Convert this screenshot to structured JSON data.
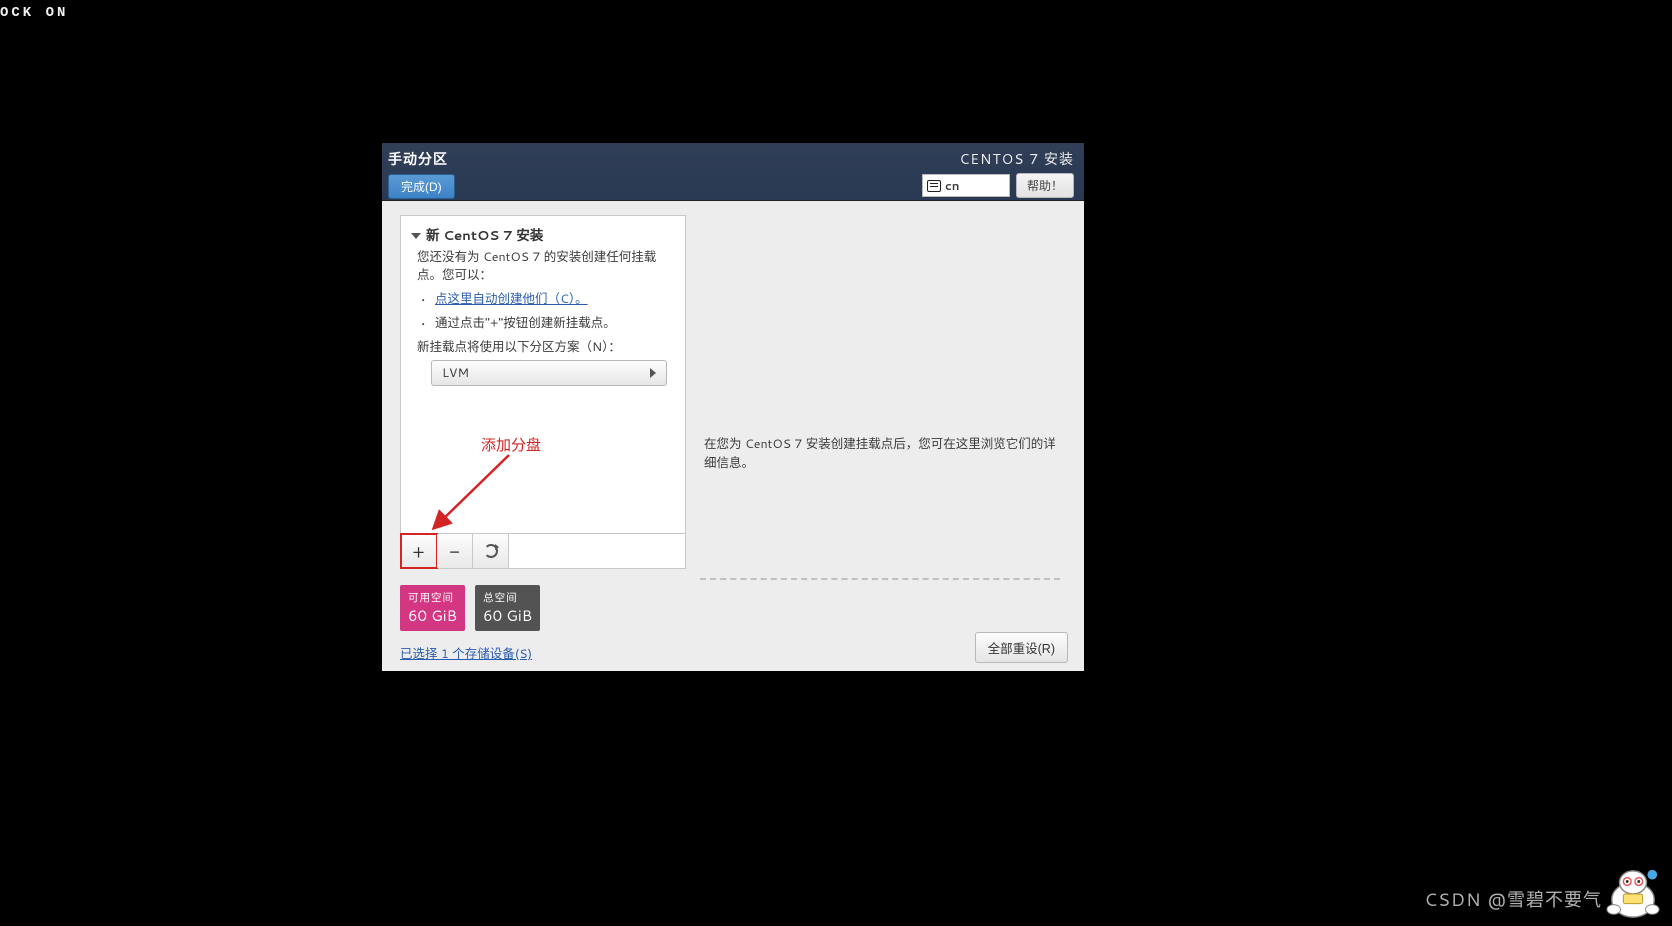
{
  "lock_indicator": "OCK ON",
  "topbar": {
    "title": "手动分区",
    "done_label": "完成(D)",
    "product": "CENTOS 7 安装",
    "lang_code": "cn",
    "help_label": "帮助！"
  },
  "left": {
    "section": "新 CentOS 7 安装",
    "intro": "您还没有为 CentOS 7 的安装创建任何挂载点。您可以：",
    "auto_link": "点这里自动创建他们（C）。",
    "manual_hint": "通过点击\"+\"按钮创建新挂载点。",
    "scheme_label": "新挂载点将使用以下分区方案（N）：",
    "scheme_value": "LVM",
    "buttons": {
      "add": "+",
      "remove": "−",
      "refresh": "↻"
    }
  },
  "right": {
    "empty_text": "在您为 CentOS 7 安装创建挂载点后，您可在这里浏览它们的详细信息。"
  },
  "summary": {
    "free_label": "可用空间",
    "free_value": "60 GiB",
    "total_label": "总空间",
    "total_value": "60 GiB",
    "storage_link": "已选择 1 个存储设备(S)",
    "reset_label": "全部重设(R)"
  },
  "annotation": {
    "label": "添加分盘"
  },
  "watermark": "CSDN @雪碧不要气"
}
